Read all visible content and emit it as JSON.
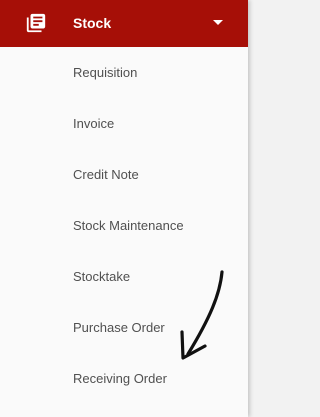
{
  "header": {
    "title": "Stock",
    "icon": "library-books-icon",
    "expand_icon": "caret-down-icon",
    "background_color": "#a60f07"
  },
  "menu": {
    "items": [
      {
        "label": "Requisition"
      },
      {
        "label": "Invoice"
      },
      {
        "label": "Credit Note"
      },
      {
        "label": "Stock Maintenance"
      },
      {
        "label": "Stocktake"
      },
      {
        "label": "Purchase Order"
      },
      {
        "label": "Receiving Order"
      }
    ]
  },
  "annotation": {
    "icon": "hand-drawn-arrow-icon",
    "points_to": "Receiving Order"
  }
}
